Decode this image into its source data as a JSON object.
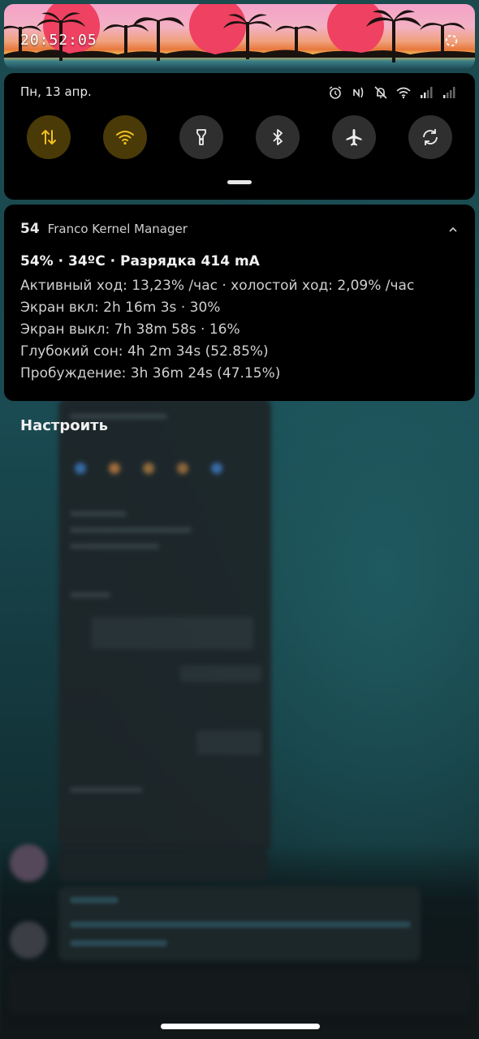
{
  "header": {
    "time": "20:52:05"
  },
  "quick_settings": {
    "date": "Пн, 13 апр.",
    "status_icons": [
      "alarm-icon",
      "nfc-icon",
      "do-not-disturb-icon",
      "wifi-signal-icon",
      "cell-signal-icon",
      "cell-signal-2-icon"
    ],
    "tiles": [
      {
        "name": "mobile-data",
        "icon": "data-arrows-icon",
        "active": true
      },
      {
        "name": "wifi",
        "icon": "wifi-icon",
        "active": true
      },
      {
        "name": "flashlight",
        "icon": "flashlight-icon",
        "active": false
      },
      {
        "name": "bluetooth",
        "icon": "bluetooth-icon",
        "active": false
      },
      {
        "name": "airplane-mode",
        "icon": "airplane-icon",
        "active": false
      },
      {
        "name": "auto-rotate",
        "icon": "rotate-icon",
        "active": false
      }
    ],
    "accent_color": "#f0c020"
  },
  "notification": {
    "app_icon_text": "54",
    "app_name": "Franco Kernel Manager",
    "title": "54% · 34ºC · Разрядка 414 mA",
    "lines": [
      "Активный ход: 13,23% /час · холостой ход: 2,09% /час",
      "Экран вкл: 2h 16m 3s  · 30%",
      "Экран выкл: 7h 38m 58s  · 16%",
      "Глубокий сон: 4h 2m 34s  (52.85%)",
      "Пробуждение: 3h 36m 24s  (47.15%)"
    ]
  },
  "manage_label": "Настроить"
}
